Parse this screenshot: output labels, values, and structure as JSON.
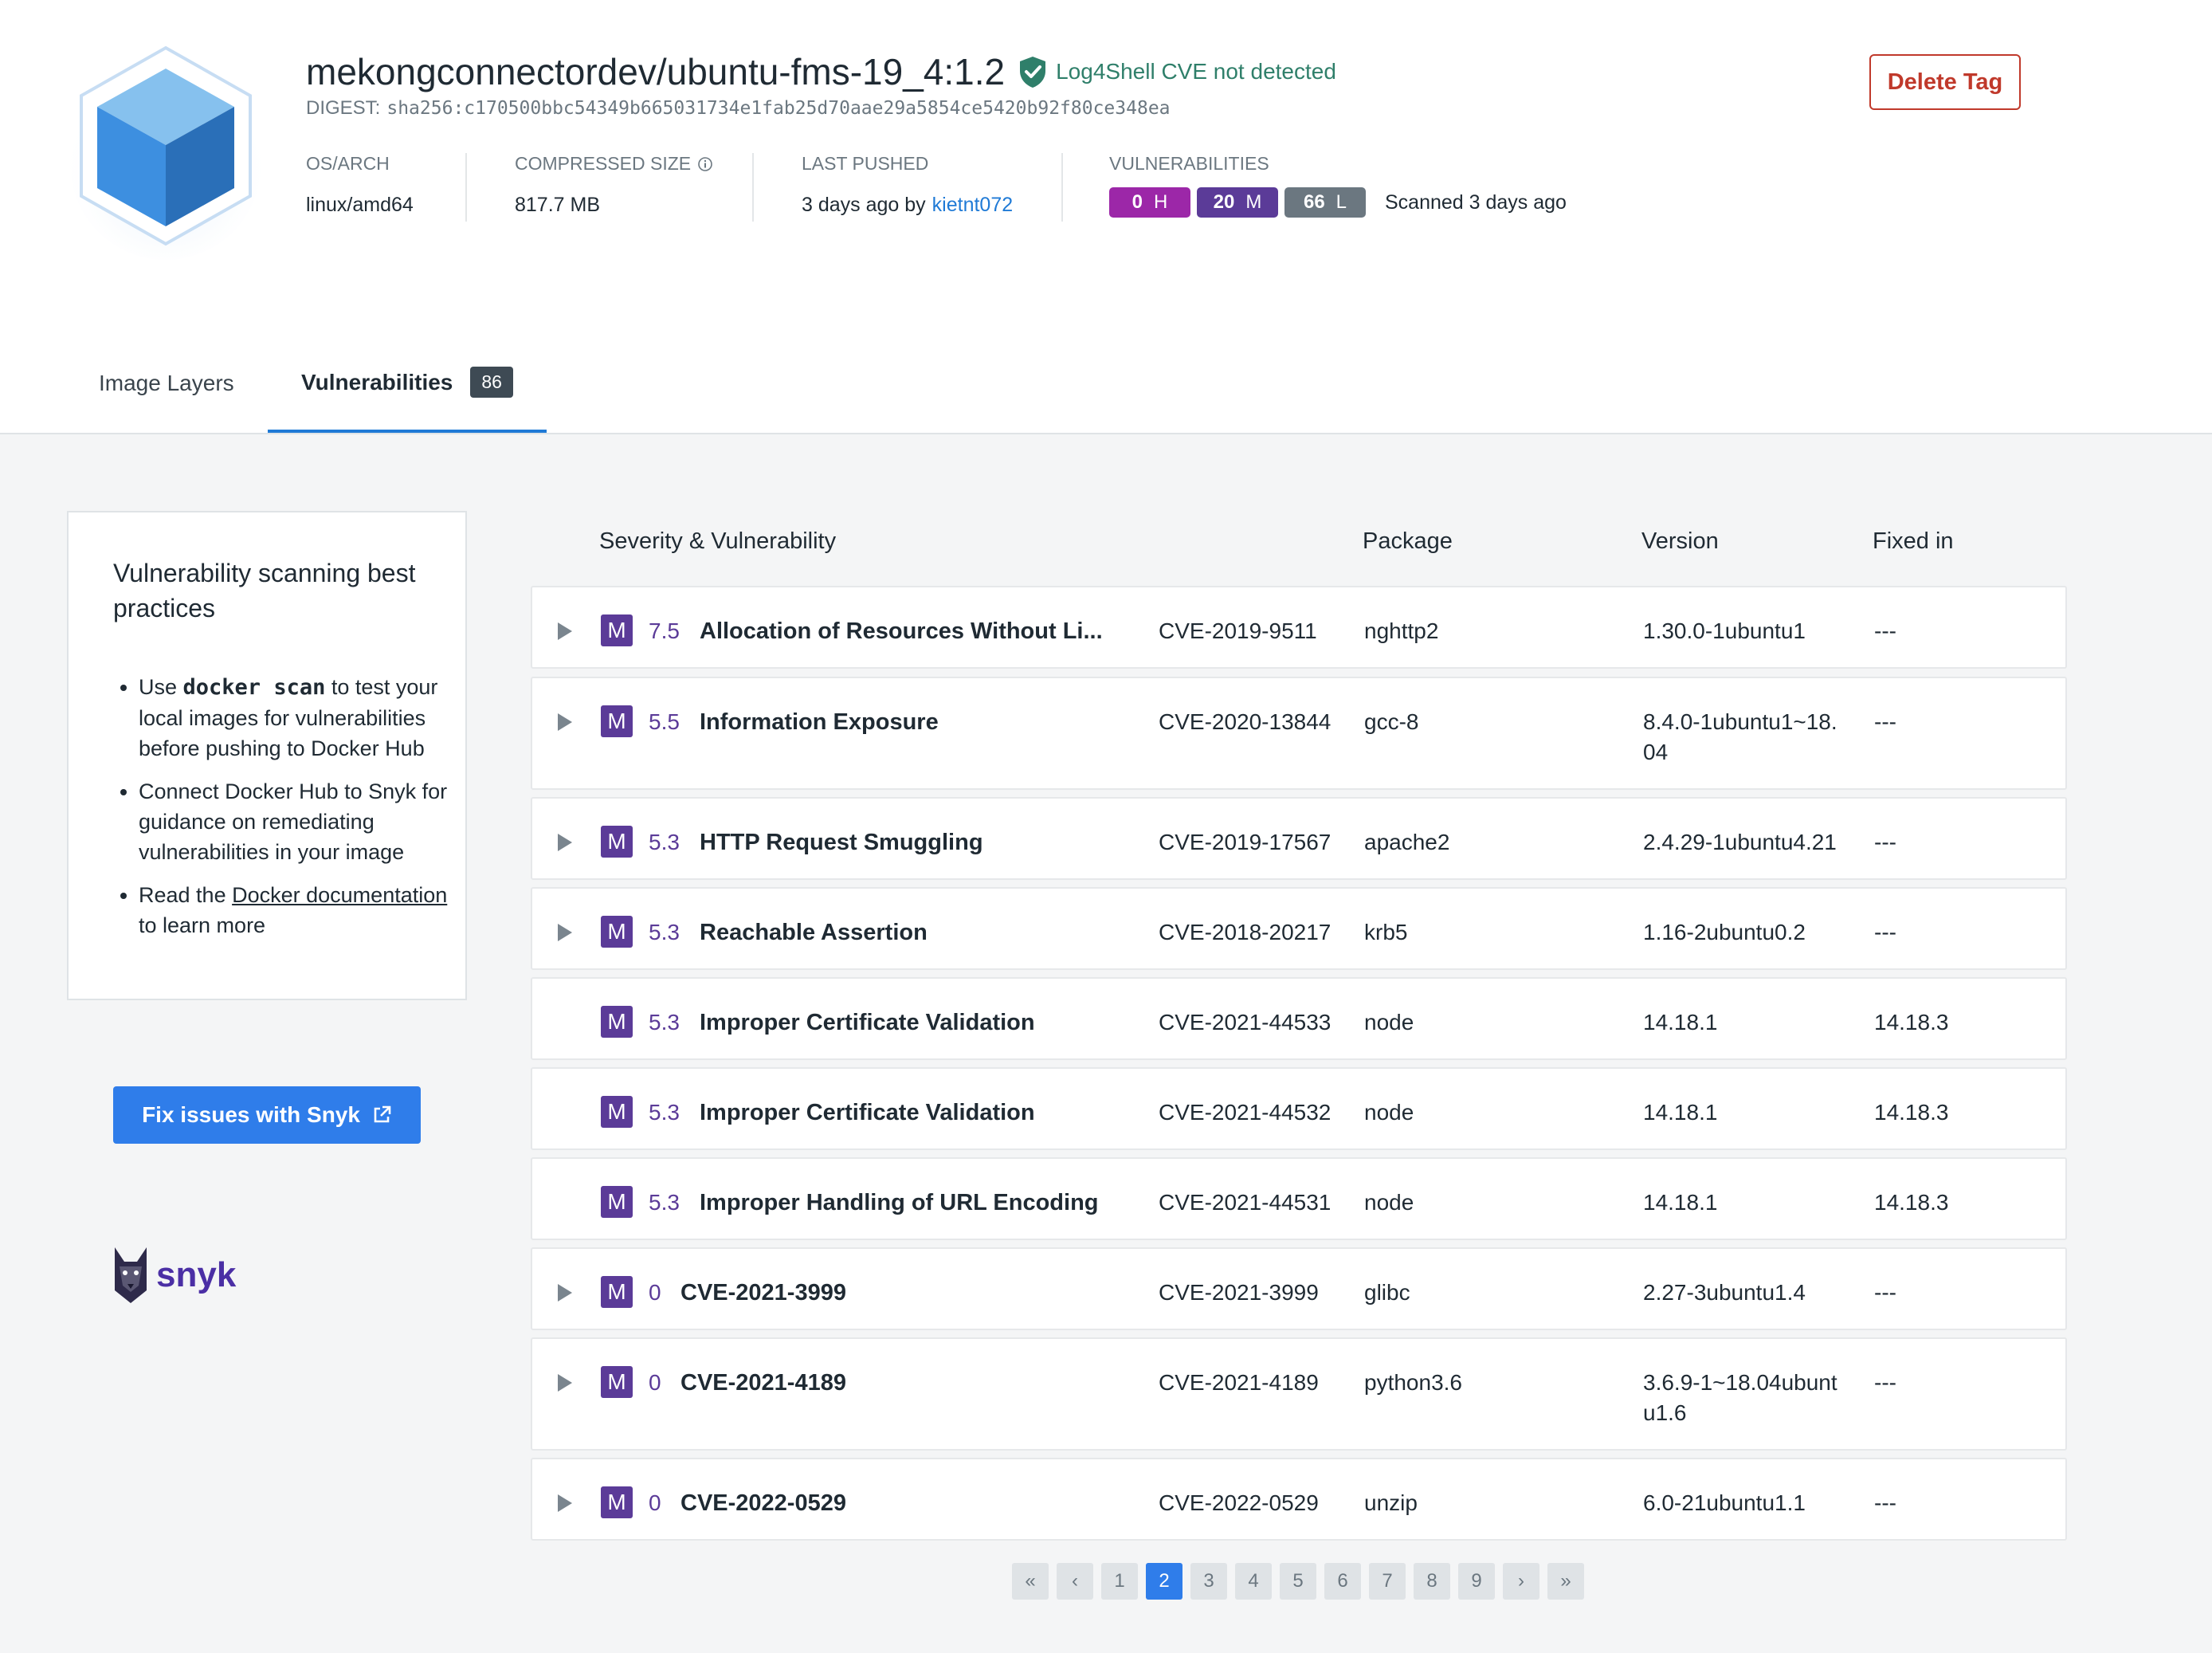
{
  "header": {
    "repo_tag": "mekongconnectordev/ubuntu-fms-19_4:1.2",
    "log4shell": "Log4Shell CVE not detected",
    "digest_label": "DIGEST:",
    "digest": "sha256:c170500bbc54349b665031734e1fab25d70aae29a5854ce5420b92f80ce348ea",
    "delete_label": "Delete Tag",
    "os_arch_label": "OS/ARCH",
    "os_arch": "linux/amd64",
    "size_label": "COMPRESSED SIZE",
    "size": "817.7 MB",
    "pushed_label": "LAST PUSHED",
    "pushed": "3 days ago by",
    "pushed_user": "kietnt072",
    "vuln_label": "VULNERABILITIES",
    "vuln_counts": {
      "h": "0",
      "h_l": "H",
      "m": "20",
      "m_l": "M",
      "l": "66",
      "l_l": "L"
    },
    "scanned": "Scanned 3 days ago"
  },
  "tabs": {
    "layers": "Image Layers",
    "vulns": "Vulnerabilities",
    "vulns_count": "86"
  },
  "sidebar": {
    "title": "Vulnerability scanning best practices",
    "b1_pre": "Use",
    "b1_code": "docker scan",
    "b1_post": "to test your local images for vulnerabilities before pushing to Docker Hub",
    "b2": "Connect Docker Hub to Snyk for guidance on remediating vulnerabilities in your image",
    "b3_pre": "Read the",
    "b3_link": "Docker documentation",
    "b3_post": "to learn more",
    "button": "Fix issues with Snyk",
    "logo_word": "snyk"
  },
  "table": {
    "headers": {
      "sev": "Severity & Vulnerability",
      "pkg": "Package",
      "ver": "Version",
      "fixed": "Fixed in"
    },
    "rows": [
      {
        "expand": true,
        "sev": "M",
        "score": "7.5",
        "name": "Allocation of Resources Without Li...",
        "cve": "CVE-2019-9511",
        "pkg": "nghttp2",
        "ver": "1.30.0-1ubuntu1",
        "fixed": "---"
      },
      {
        "expand": true,
        "sev": "M",
        "score": "5.5",
        "name": "Information Exposure",
        "cve": "CVE-2020-13844",
        "pkg": "gcc-8",
        "ver": "8.4.0-1ubuntu1~18.04",
        "fixed": "---"
      },
      {
        "expand": true,
        "sev": "M",
        "score": "5.3",
        "name": "HTTP Request Smuggling",
        "cve": "CVE-2019-17567",
        "pkg": "apache2",
        "ver": "2.4.29-1ubuntu4.21",
        "fixed": "---"
      },
      {
        "expand": true,
        "sev": "M",
        "score": "5.3",
        "name": "Reachable Assertion",
        "cve": "CVE-2018-20217",
        "pkg": "krb5",
        "ver": "1.16-2ubuntu0.2",
        "fixed": "---"
      },
      {
        "expand": false,
        "sev": "M",
        "score": "5.3",
        "name": "Improper Certificate Validation",
        "cve": "CVE-2021-44533",
        "pkg": "node",
        "ver": "14.18.1",
        "fixed": "14.18.3"
      },
      {
        "expand": false,
        "sev": "M",
        "score": "5.3",
        "name": "Improper Certificate Validation",
        "cve": "CVE-2021-44532",
        "pkg": "node",
        "ver": "14.18.1",
        "fixed": "14.18.3"
      },
      {
        "expand": false,
        "sev": "M",
        "score": "5.3",
        "name": "Improper Handling of URL Encoding",
        "cve": "CVE-2021-44531",
        "pkg": "node",
        "ver": "14.18.1",
        "fixed": "14.18.3"
      },
      {
        "expand": true,
        "sev": "M",
        "score": "0",
        "name": "CVE-2021-3999",
        "cve": "CVE-2021-3999",
        "pkg": "glibc",
        "ver": "2.27-3ubuntu1.4",
        "fixed": "---"
      },
      {
        "expand": true,
        "sev": "M",
        "score": "0",
        "name": "CVE-2021-4189",
        "cve": "CVE-2021-4189",
        "pkg": "python3.6",
        "ver": "3.6.9-1~18.04ubuntu1.6",
        "fixed": "---"
      },
      {
        "expand": true,
        "sev": "M",
        "score": "0",
        "name": "CVE-2022-0529",
        "cve": "CVE-2022-0529",
        "pkg": "unzip",
        "ver": "6.0-21ubuntu1.1",
        "fixed": "---"
      }
    ]
  },
  "pager": {
    "first": "«",
    "prev": "‹",
    "next": "›",
    "last": "»",
    "pages": [
      "1",
      "2",
      "3",
      "4",
      "5",
      "6",
      "7",
      "8",
      "9"
    ],
    "current": "2"
  },
  "colors": {
    "accent": "#2f7dea",
    "medium": "#5b3b98",
    "high": "#9c27a8",
    "low": "#6b7780",
    "danger": "#c0392b"
  }
}
